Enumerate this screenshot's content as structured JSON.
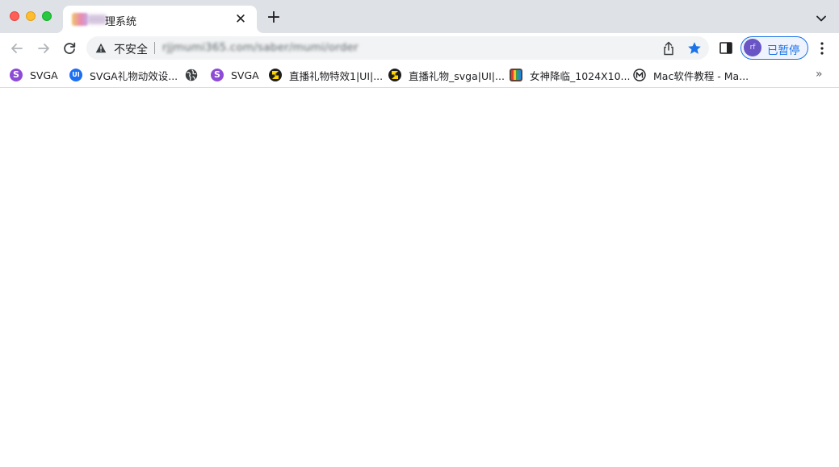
{
  "window": {
    "controls": [
      "close",
      "minimize",
      "maximize"
    ]
  },
  "tab": {
    "title": "理系统",
    "close_glyph": "✕",
    "new_tab_glyph": "+"
  },
  "toolbar": {
    "security_label": "不安全",
    "url": "rjjmumi365.com/saber/mumi/order",
    "profile_label": "已暂停",
    "profile_avatar_text": "rf"
  },
  "bookmarks": {
    "items": [
      {
        "label": "SVGA",
        "icon": "svga-s-icon",
        "icon_text": "S"
      },
      {
        "label": "SVGA礼物动效设...",
        "icon": "ui-logo-icon",
        "icon_text": "UI"
      },
      {
        "label": "",
        "icon": "globe-icon",
        "icon_text": ""
      },
      {
        "label": "SVGA",
        "icon": "svga-s-icon",
        "icon_text": "S"
      },
      {
        "label": "直播礼物特效1|UI|...",
        "icon": "zcool-icon",
        "icon_text": ""
      },
      {
        "label": "直播礼物_svga|UI|...",
        "icon": "zcool-icon",
        "icon_text": ""
      },
      {
        "label": "女神降临_1024X10...",
        "icon": "tv-icon",
        "icon_text": ""
      },
      {
        "label": "Mac软件教程 - Ma...",
        "icon": "mac-m-icon",
        "icon_text": ""
      }
    ],
    "overflow_glyph": "»"
  },
  "colors": {
    "tabstrip": "#dee1e6",
    "accent": "#1a73e8",
    "star": "#1a73e8",
    "avatar": "#6a55c4"
  }
}
